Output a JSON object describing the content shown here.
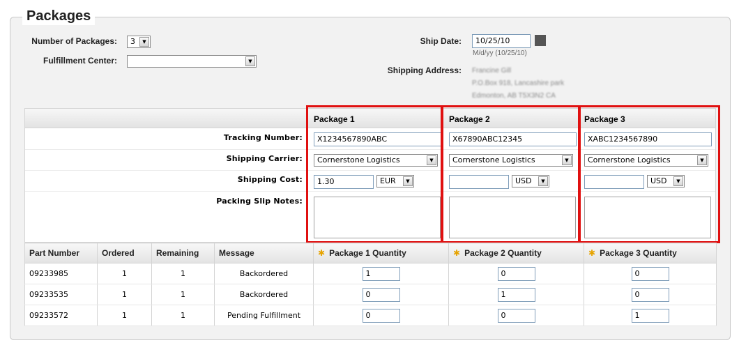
{
  "title": "Packages",
  "form": {
    "num_packages_label": "Number of Packages:",
    "num_packages_value": "3",
    "fulfillment_label": "Fulfillment Center:",
    "fulfillment_value": "",
    "ship_date_label": "Ship Date:",
    "ship_date_value": "10/25/10",
    "ship_date_hint": "M/d/yy (10/25/10)",
    "shipping_address_label": "Shipping Address:",
    "address_lines": [
      "Francine Gill",
      "P.O.Box 918, Lancashire park",
      "Edmonton, AB T5X3N2 CA"
    ]
  },
  "row_labels": {
    "tracking": "Tracking Number:",
    "carrier": "Shipping Carrier:",
    "cost": "Shipping Cost:",
    "notes": "Packing Slip Notes:"
  },
  "packages": [
    {
      "header": "Package 1",
      "tracking": "X1234567890ABC",
      "carrier": "Cornerstone Logistics",
      "cost": "1.30",
      "currency": "EUR"
    },
    {
      "header": "Package 2",
      "tracking": "X67890ABC12345",
      "carrier": "Cornerstone Logistics",
      "cost": "",
      "currency": "USD"
    },
    {
      "header": "Package 3",
      "tracking": "XABC1234567890",
      "carrier": "Cornerstone Logistics",
      "cost": "",
      "currency": "USD"
    }
  ],
  "grid": {
    "headers": [
      "Part Number",
      "Ordered",
      "Remaining",
      "Message",
      "Package 1 Quantity",
      "Package 2 Quantity",
      "Package 3 Quantity"
    ],
    "rows": [
      {
        "part": "09233985",
        "ordered": "1",
        "remaining": "1",
        "message": "Backordered",
        "q1": "1",
        "q2": "0",
        "q3": "0"
      },
      {
        "part": "09233535",
        "ordered": "1",
        "remaining": "1",
        "message": "Backordered",
        "q1": "0",
        "q2": "1",
        "q3": "0"
      },
      {
        "part": "09233572",
        "ordered": "1",
        "remaining": "1",
        "message": "Pending Fulfillment",
        "q1": "0",
        "q2": "0",
        "q3": "1"
      }
    ]
  },
  "icons": {
    "calendar": "calendar-icon",
    "dropdown": "chevron-down-icon",
    "required": "asterisk-icon"
  },
  "colors": {
    "highlight": "#e01010",
    "required_star": "#e6a300"
  }
}
